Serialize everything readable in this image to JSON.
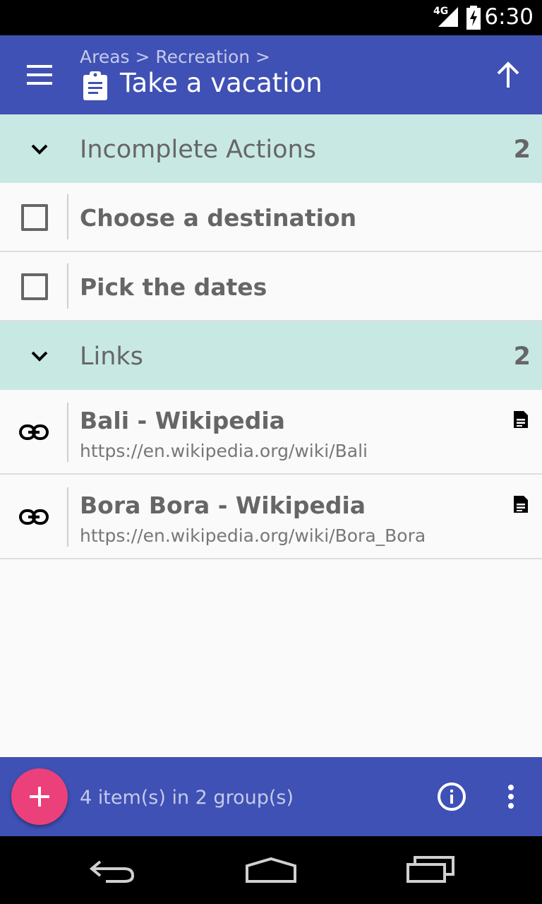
{
  "status_bar": {
    "network": "4G",
    "time": "6:30",
    "icons": [
      "signal-icon",
      "battery-icon"
    ]
  },
  "app_bar": {
    "breadcrumb": "Areas > Recreation >",
    "title": "Take a vacation",
    "color": "#3f51b5",
    "icons": [
      "menu-icon",
      "clipboard-icon",
      "arrow-up-icon"
    ]
  },
  "groups": [
    {
      "title": "Incomplete Actions",
      "count": "2",
      "items": [
        {
          "title": "Choose a destination",
          "icon": "checkbox-unchecked-icon"
        },
        {
          "title": "Pick the dates",
          "icon": "checkbox-unchecked-icon"
        }
      ]
    },
    {
      "title": "Links",
      "count": "2",
      "items": [
        {
          "title": "Bali - Wikipedia",
          "url": "https://en.wikipedia.org/wiki/Bali",
          "icon": "link-icon",
          "action_icon": "document-icon"
        },
        {
          "title": "Bora Bora - Wikipedia",
          "url": "https://en.wikipedia.org/wiki/Bora_Bora",
          "icon": "link-icon",
          "action_icon": "document-icon"
        }
      ]
    }
  ],
  "group_header_color": "#c8e8e4",
  "footer": {
    "summary": "4 item(s) in 2 group(s)",
    "icons": [
      "add-icon",
      "info-icon",
      "more-vert-icon"
    ],
    "fab_color": "#ec407a"
  },
  "nav_bar": {
    "icons": [
      "back-icon",
      "home-icon",
      "recents-icon"
    ]
  }
}
